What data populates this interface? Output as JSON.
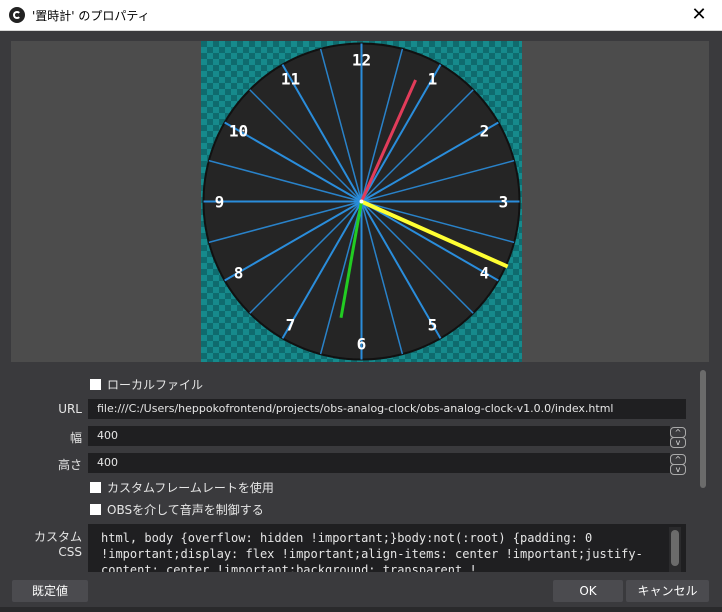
{
  "window": {
    "title": "'置時計' のプロパティ",
    "close_glyph": "✕"
  },
  "clock": {
    "numbers": [
      "1",
      "2",
      "3",
      "4",
      "5",
      "6",
      "7",
      "8",
      "9",
      "10",
      "11",
      "12"
    ],
    "face_color": "#252525",
    "hand_colors": {
      "hour": "#ffff33",
      "minute": "#22cc22",
      "second": "#e23c5a"
    },
    "line_color": "#2a8ddb"
  },
  "properties": {
    "local_file_label": "ローカルファイル",
    "url_label": "URL",
    "url_value": "file:///C:/Users/heppokofrontend/projects/obs-analog-clock/obs-analog-clock-v1.0.0/index.html",
    "width_label": "幅",
    "width_value": "400",
    "height_label": "高さ",
    "height_value": "400",
    "custom_framerate_label": "カスタムフレームレートを使用",
    "obs_audio_label": "OBSを介して音声を制御する",
    "custom_css_label": "カスタム CSS",
    "custom_css_value": "html, body {overflow: hidden !important;}body:not(:root) {padding: 0 !important;display: flex !important;align-items: center !important;justify-content: center !important;background: transparent !"
  },
  "buttons": {
    "defaults": "既定値",
    "ok": "OK",
    "cancel": "キャンセル"
  }
}
